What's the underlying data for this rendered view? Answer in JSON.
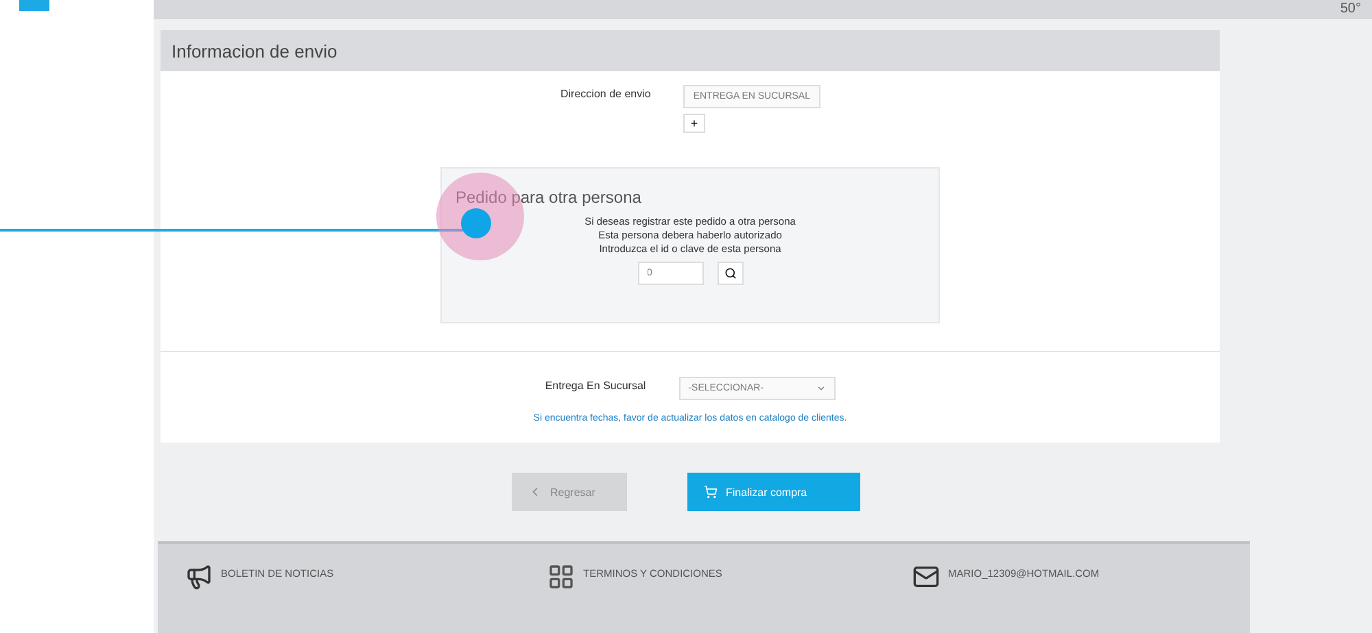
{
  "top_bar": {
    "temperature": "50°"
  },
  "section": {
    "title": "Informacion de envio",
    "address": {
      "label": "Direccion de envio",
      "value": "ENTREGA EN SUCURSAL",
      "add_button": "+"
    },
    "other_person": {
      "title": "Pedido para otra persona",
      "lines": [
        "Si deseas registrar este pedido a otra persona",
        "Esta persona debera haberlo autorizado",
        "Introduzca el id o clave de esta persona"
      ],
      "id_value": "0"
    },
    "branch": {
      "label": "Entrega En Sucursal",
      "value": "-SELECCIONAR-"
    },
    "notice_link": "Si encuentra fechas, favor de actualizar los datos en catalogo de clientes."
  },
  "buttons": [
    {
      "kind": "back",
      "label": "Regresar"
    },
    {
      "kind": "primary",
      "label": "Finalizar compra"
    }
  ],
  "footer": {
    "newsletter": "BOLETIN DE NOTICIAS",
    "terms": "TERMINOS Y CONDICIONES",
    "email": "MARIO_12309@HOTMAIL.COM"
  }
}
